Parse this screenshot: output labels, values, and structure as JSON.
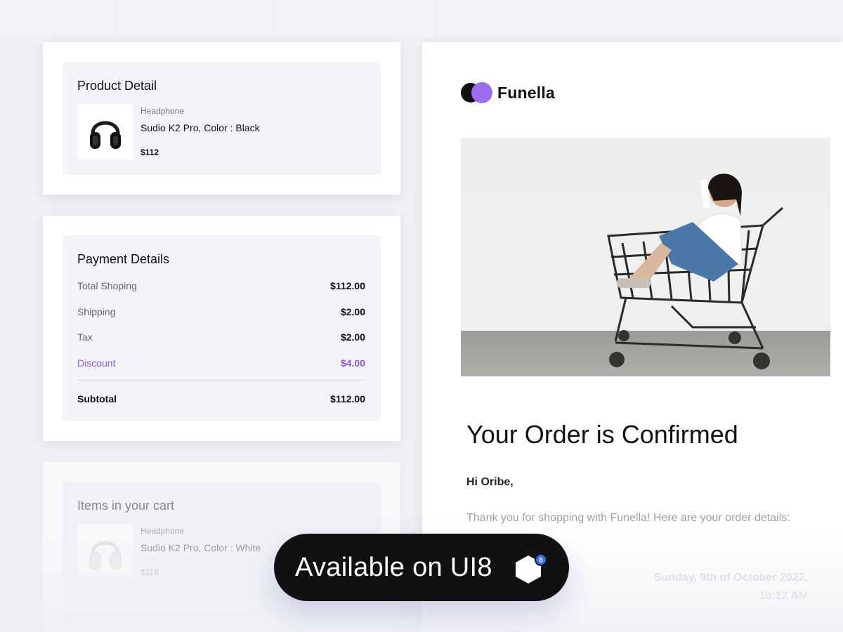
{
  "product_detail": {
    "title": "Product Detail",
    "category": "Headphone",
    "name": "Sudio K2 Pro, Color : Black",
    "price": "$112"
  },
  "payment": {
    "title": "Payment Details",
    "rows": [
      {
        "label": "Total Shoping",
        "value": "$112.00"
      },
      {
        "label": "Shipping",
        "value": "$2.00"
      },
      {
        "label": "Tax",
        "value": "$2.00"
      },
      {
        "label": "Discount",
        "value": "$4.00"
      }
    ],
    "subtotal": {
      "label": "Subtotal",
      "value": "$112.00"
    }
  },
  "cart": {
    "title": "Items in your cart",
    "category": "Headphone",
    "name": "Sudio K2 Pro, Color : White",
    "price": "$119"
  },
  "email": {
    "brand": "Funella",
    "heading": "Your Order is Confirmed",
    "greeting": "Hi Oribe,",
    "message": "Thank you for shopping with Funella! Here are your order details:",
    "date": "Sunday, 9th of October 2022,",
    "time": "10:12 AM"
  },
  "promo": {
    "label": "Available on UI8",
    "badge_count": "8"
  },
  "colors": {
    "accent": "#9b6cf0",
    "discount": "#8a5ad6",
    "pill": "#111111"
  }
}
